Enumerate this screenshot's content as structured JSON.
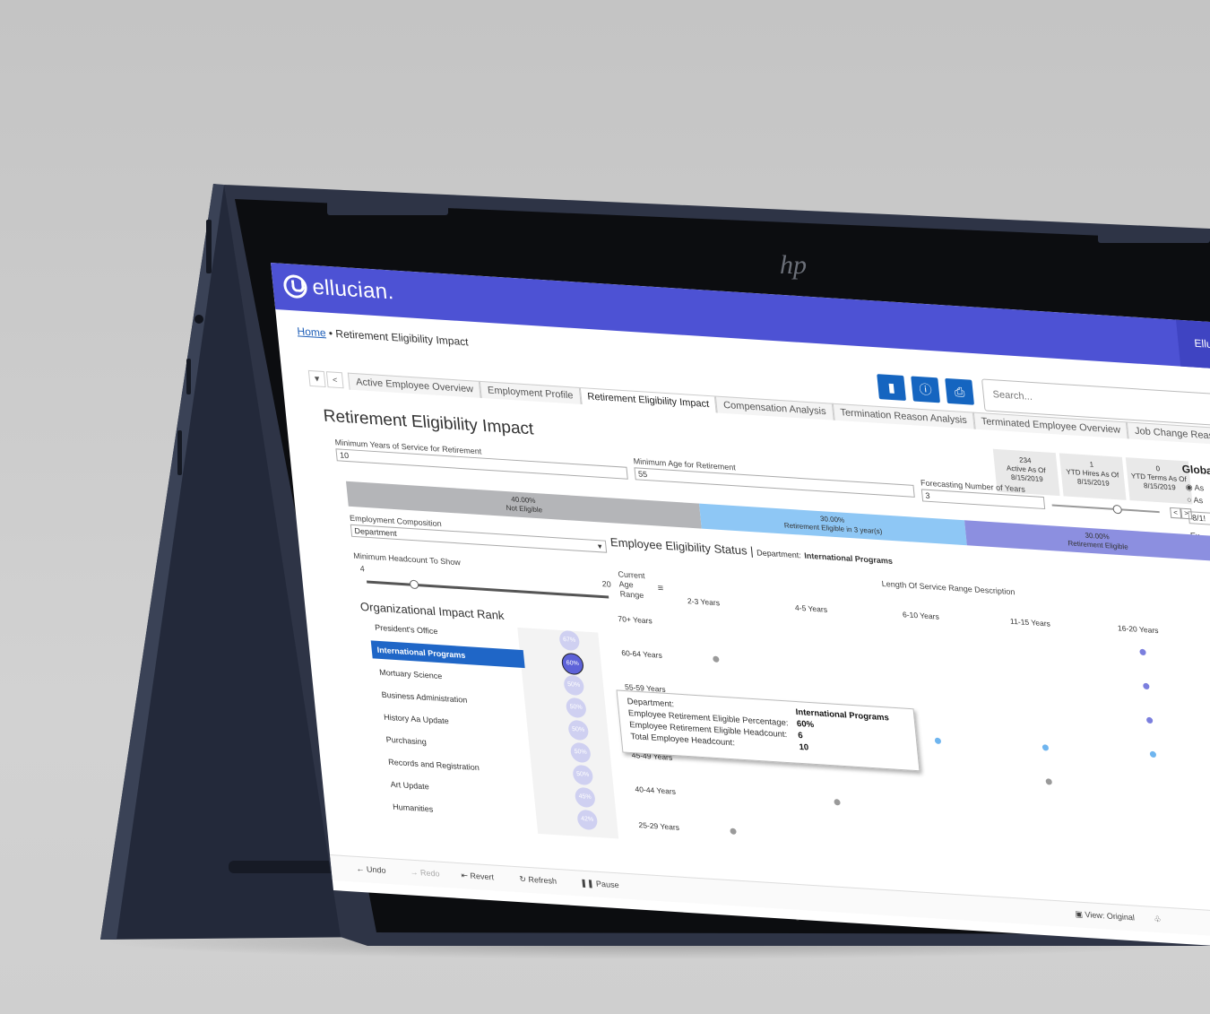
{
  "brand": {
    "logo": "ellucian.",
    "header_user": "Ellu"
  },
  "breadcrumb": {
    "home": "Home",
    "separator": "•",
    "current": "Retirement Eligibility Impact"
  },
  "toolbar": {
    "icons": [
      "bookmark-icon",
      "info-icon",
      "print-icon"
    ],
    "search_placeholder": "Search..."
  },
  "tabs": [
    "Active Employee Overview",
    "Employment Profile",
    "Retirement Eligibility Impact",
    "Compensation Analysis",
    "Termination Reason Analysis",
    "Terminated Employee Overview",
    "Job Change Reason Analysis"
  ],
  "active_tab": 2,
  "page_title": "Retirement Eligibility Impact",
  "kpis": [
    {
      "value": "234",
      "label": "Active As Of",
      "date": "8/15/2019"
    },
    {
      "value": "1",
      "label": "YTD Hires As Of",
      "date": "8/15/2019"
    },
    {
      "value": "0",
      "label": "YTD Terms As Of",
      "date": "8/15/2019"
    }
  ],
  "global_panel": {
    "title": "Globa",
    "opt1": "As",
    "opt2": "As",
    "date": "8/1!",
    "ex": "Ex",
    "sel": "(A"
  },
  "filters": {
    "min_years_label": "Minimum Years of Service for Retirement",
    "min_years_value": "10",
    "min_age_label": "Minimum Age for Retirement",
    "min_age_value": "55",
    "forecast_label": "Forecasting Number of Years",
    "forecast_value": "3",
    "composition_label": "Employment Composition",
    "composition_value": "Department",
    "headcount_label": "Minimum Headcount To Show",
    "headcount_min": "4",
    "headcount_max": "20"
  },
  "eligibility_bar": [
    {
      "pct": "40.00%",
      "label": "Not Eligible",
      "share": 0.4,
      "color": "#b4b5b8"
    },
    {
      "pct": "30.00%",
      "label": "Retirement Eligible in 3 year(s)",
      "share": 0.3,
      "color": "#8ec7f5"
    },
    {
      "pct": "30.00%",
      "label": "Retirement Eligible",
      "share": 0.3,
      "color": "#8c8fe0"
    }
  ],
  "rank": {
    "title": "Organizational Impact Rank",
    "items": [
      {
        "name": "President's Office",
        "pct": "67%"
      },
      {
        "name": "International Programs",
        "pct": "60%",
        "selected": true
      },
      {
        "name": "Mortuary Science",
        "pct": "50%"
      },
      {
        "name": "Business Administration",
        "pct": "50%"
      },
      {
        "name": "History Aa Update",
        "pct": "50%"
      },
      {
        "name": "Purchasing",
        "pct": "50%"
      },
      {
        "name": "Records and Registration",
        "pct": "50%"
      },
      {
        "name": "Art Update",
        "pct": "45%"
      },
      {
        "name": "Humanities",
        "pct": "42%"
      }
    ]
  },
  "status": {
    "title": "Employee Eligibility Status |",
    "dept_label": "Department:",
    "dept_value": "International Programs",
    "col_group": "Length Of Service Range Description",
    "row_header": "Current Age Range",
    "columns": [
      "2-3 Years",
      "4-5 Years",
      "6-10 Years",
      "11-15 Years",
      "16-20 Years"
    ],
    "rows": [
      "70+ Years",
      "60-64 Years",
      "55-59 Years",
      "50-54 Years",
      "45-49 Years",
      "40-44 Years",
      "25-29 Years"
    ]
  },
  "chart_data": {
    "type": "scatter",
    "title": "Employee Eligibility Status",
    "xlabel": "Length Of Service Range Description",
    "ylabel": "Current Age Range",
    "categories_x": [
      "2-3 Years",
      "4-5 Years",
      "6-10 Years",
      "11-15 Years",
      "16-20 Years"
    ],
    "categories_y": [
      "70+ Years",
      "60-64 Years",
      "55-59 Years",
      "50-54 Years",
      "45-49 Years",
      "40-44 Years",
      "25-29 Years"
    ],
    "points": [
      {
        "x": "16-20 Years",
        "y": "70+ Years",
        "status": "Retirement Eligible",
        "color": "#7b7fde"
      },
      {
        "x": "2-3 Years",
        "y": "60-64 Years",
        "status": "Not Eligible",
        "color": "#9a9a9a"
      },
      {
        "x": "16-20 Years",
        "y": "60-64 Years",
        "status": "Retirement Eligible",
        "color": "#7b7fde"
      },
      {
        "x": "16-20 Years",
        "y": "55-59 Years",
        "status": "Retirement Eligible",
        "color": "#7b7fde"
      },
      {
        "x": "6-10 Years",
        "y": "50-54 Years",
        "status": "Retirement Eligible in 3 year(s)",
        "color": "#6fb5ef"
      },
      {
        "x": "11-15 Years",
        "y": "50-54 Years",
        "status": "Retirement Eligible in 3 year(s)",
        "color": "#6fb5ef"
      },
      {
        "x": "16-20 Years",
        "y": "50-54 Years",
        "status": "Retirement Eligible in 3 year(s)",
        "color": "#6fb5ef"
      },
      {
        "x": "11-15 Years",
        "y": "45-49 Years",
        "status": "Not Eligible",
        "color": "#9a9a9a"
      },
      {
        "x": "4-5 Years",
        "y": "40-44 Years",
        "status": "Not Eligible",
        "color": "#9a9a9a"
      },
      {
        "x": "2-3 Years",
        "y": "25-29 Years",
        "status": "Not Eligible",
        "color": "#9a9a9a"
      }
    ]
  },
  "tooltip": {
    "rows": [
      {
        "k": "Department:",
        "v": "International Programs"
      },
      {
        "k": "Employee Retirement Eligible Percentage:",
        "v": "60%"
      },
      {
        "k": "Employee Retirement Eligible Headcount:",
        "v": "6"
      },
      {
        "k": "Total Employee Headcount:",
        "v": "10"
      }
    ]
  },
  "footer": {
    "undo": "Undo",
    "redo": "Redo",
    "revert": "Revert",
    "refresh": "Refresh",
    "pause": "Pause",
    "view": "View: Original"
  }
}
